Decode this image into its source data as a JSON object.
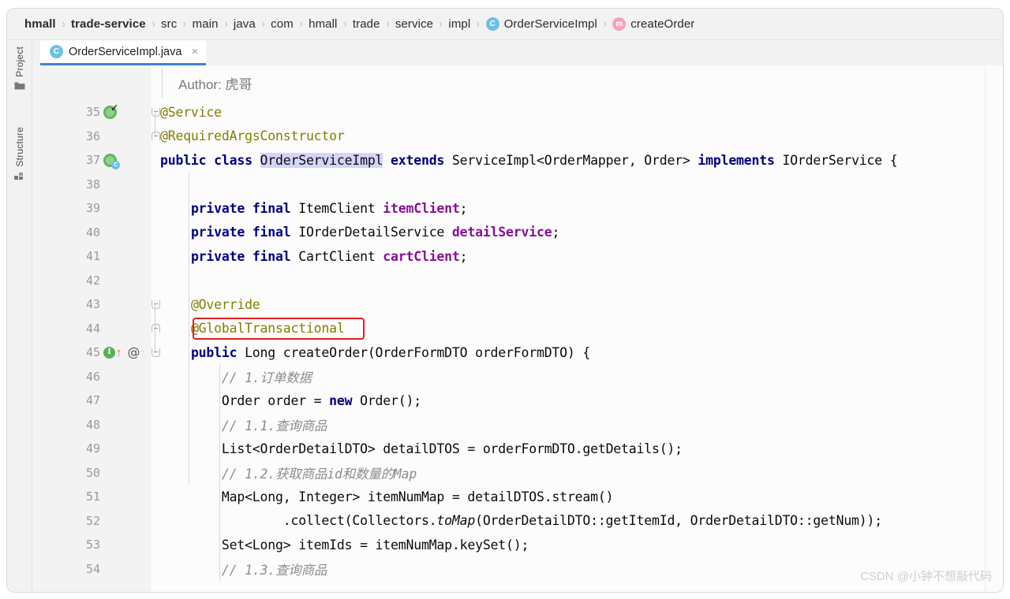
{
  "breadcrumb": {
    "separator": "›",
    "items": [
      {
        "label": "hmall",
        "bold": true,
        "icon": ""
      },
      {
        "label": "trade-service",
        "bold": true,
        "icon": ""
      },
      {
        "label": "src",
        "bold": false,
        "icon": ""
      },
      {
        "label": "main",
        "bold": false,
        "icon": ""
      },
      {
        "label": "java",
        "bold": false,
        "icon": ""
      },
      {
        "label": "com",
        "bold": false,
        "icon": ""
      },
      {
        "label": "hmall",
        "bold": false,
        "icon": ""
      },
      {
        "label": "trade",
        "bold": false,
        "icon": ""
      },
      {
        "label": "service",
        "bold": false,
        "icon": ""
      },
      {
        "label": "impl",
        "bold": false,
        "icon": ""
      },
      {
        "label": "OrderServiceImpl",
        "bold": false,
        "icon": "class-icon",
        "icon_char": "C"
      },
      {
        "label": "createOrder",
        "bold": false,
        "icon": "method-icon",
        "icon_char": "m"
      }
    ]
  },
  "tool_strip": {
    "project_label": "Project",
    "project_icon": "folder-icon",
    "structure_label": "Structure",
    "structure_icon": "blocks-icon"
  },
  "tab": {
    "icon_char": "C",
    "title": "OrderServiceImpl.java",
    "close_char": "×"
  },
  "editor": {
    "doc_comment": "Author: 虎哥",
    "lines": [
      {
        "no": "35",
        "gutter": "spring-bean-check",
        "fold": "down",
        "indent": 0,
        "tokens": [
          {
            "t": "@Service",
            "c": "ann"
          }
        ]
      },
      {
        "no": "36",
        "gutter": "",
        "fold": "up",
        "indent": 0,
        "tokens": [
          {
            "t": "@RequiredArgsConstructor",
            "c": "ann"
          }
        ]
      },
      {
        "no": "37",
        "gutter": "spring-bean-class",
        "fold": "",
        "indent": 0,
        "tokens": [
          {
            "t": "public",
            "c": "kw"
          },
          {
            "t": " ",
            "c": ""
          },
          {
            "t": "class",
            "c": "kw"
          },
          {
            "t": " ",
            "c": ""
          },
          {
            "t": "OrderServiceImpl",
            "c": "hl-sel"
          },
          {
            "t": " ",
            "c": ""
          },
          {
            "t": "extends",
            "c": "kw"
          },
          {
            "t": " ServiceImpl<OrderMapper, Order> ",
            "c": ""
          },
          {
            "t": "implements",
            "c": "kw"
          },
          {
            "t": " IOrderService {",
            "c": ""
          }
        ]
      },
      {
        "no": "38",
        "gutter": "",
        "fold": "",
        "indent": 0,
        "tokens": []
      },
      {
        "no": "39",
        "gutter": "",
        "fold": "",
        "indent": 1,
        "tokens": [
          {
            "t": "    ",
            "c": ""
          },
          {
            "t": "private",
            "c": "kw"
          },
          {
            "t": " ",
            "c": ""
          },
          {
            "t": "final",
            "c": "kw"
          },
          {
            "t": " ItemClient ",
            "c": ""
          },
          {
            "t": "itemClient",
            "c": "field"
          },
          {
            "t": ";",
            "c": ""
          }
        ]
      },
      {
        "no": "40",
        "gutter": "",
        "fold": "",
        "indent": 1,
        "tokens": [
          {
            "t": "    ",
            "c": ""
          },
          {
            "t": "private",
            "c": "kw"
          },
          {
            "t": " ",
            "c": ""
          },
          {
            "t": "final",
            "c": "kw"
          },
          {
            "t": " IOrderDetailService ",
            "c": ""
          },
          {
            "t": "detailService",
            "c": "field"
          },
          {
            "t": ";",
            "c": ""
          }
        ]
      },
      {
        "no": "41",
        "gutter": "",
        "fold": "",
        "indent": 1,
        "tokens": [
          {
            "t": "    ",
            "c": ""
          },
          {
            "t": "private",
            "c": "kw"
          },
          {
            "t": " ",
            "c": ""
          },
          {
            "t": "final",
            "c": "kw"
          },
          {
            "t": " CartClient ",
            "c": ""
          },
          {
            "t": "cartClient",
            "c": "field"
          },
          {
            "t": ";",
            "c": ""
          }
        ]
      },
      {
        "no": "42",
        "gutter": "",
        "fold": "",
        "indent": 1,
        "tokens": []
      },
      {
        "no": "43",
        "gutter": "",
        "fold": "down",
        "indent": 1,
        "tokens": [
          {
            "t": "    ",
            "c": ""
          },
          {
            "t": "@Override",
            "c": "ann"
          }
        ]
      },
      {
        "no": "44",
        "gutter": "",
        "fold": "up",
        "indent": 1,
        "tokens": [
          {
            "t": "    ",
            "c": ""
          },
          {
            "t": "@GlobalTransactional",
            "c": "ann"
          }
        ]
      },
      {
        "no": "45",
        "gutter": "implements-method",
        "fold": "down",
        "indent": 1,
        "tokens": [
          {
            "t": "    ",
            "c": ""
          },
          {
            "t": "public",
            "c": "kw"
          },
          {
            "t": " Long createOrder(OrderFormDTO orderFormDTO) {",
            "c": ""
          }
        ]
      },
      {
        "no": "46",
        "gutter": "",
        "fold": "",
        "indent": 2,
        "tokens": [
          {
            "t": "        ",
            "c": ""
          },
          {
            "t": "// 1.订单数据",
            "c": "cmt"
          }
        ]
      },
      {
        "no": "47",
        "gutter": "",
        "fold": "",
        "indent": 2,
        "tokens": [
          {
            "t": "        Order order = ",
            "c": ""
          },
          {
            "t": "new",
            "c": "kw"
          },
          {
            "t": " Order();",
            "c": ""
          }
        ]
      },
      {
        "no": "48",
        "gutter": "",
        "fold": "",
        "indent": 2,
        "tokens": [
          {
            "t": "        ",
            "c": ""
          },
          {
            "t": "// 1.1.查询商品",
            "c": "cmt"
          }
        ]
      },
      {
        "no": "49",
        "gutter": "",
        "fold": "",
        "indent": 2,
        "tokens": [
          {
            "t": "        List<OrderDetailDTO> detailDTOS = orderFormDTO.getDetails();",
            "c": ""
          }
        ]
      },
      {
        "no": "50",
        "gutter": "",
        "fold": "",
        "indent": 2,
        "tokens": [
          {
            "t": "        ",
            "c": ""
          },
          {
            "t": "// 1.2.获取商品id和数量的Map",
            "c": "cmt"
          }
        ]
      },
      {
        "no": "51",
        "gutter": "",
        "fold": "",
        "indent": 2,
        "tokens": [
          {
            "t": "        Map<Long, Integer> itemNumMap = detailDTOS.stream()",
            "c": ""
          }
        ]
      },
      {
        "no": "52",
        "gutter": "",
        "fold": "",
        "indent": 2,
        "tokens": [
          {
            "t": "                .collect(Collectors.",
            "c": ""
          },
          {
            "t": "toMap",
            "c": "stat"
          },
          {
            "t": "(OrderDetailDTO::getItemId, OrderDetailDTO::getNum));",
            "c": ""
          }
        ]
      },
      {
        "no": "53",
        "gutter": "",
        "fold": "",
        "indent": 2,
        "tokens": [
          {
            "t": "        Set<Long> itemIds = itemNumMap.keySet();",
            "c": ""
          }
        ]
      },
      {
        "no": "54",
        "gutter": "",
        "fold": "",
        "indent": 2,
        "tokens": [
          {
            "t": "        ",
            "c": ""
          },
          {
            "t": "// 1.3.查询商品",
            "c": "cmt"
          }
        ]
      }
    ]
  },
  "annotation": {
    "highlight_target": "@GlobalTransactional",
    "color": "#e02020"
  },
  "watermark": "CSDN @小钟不想敲代码",
  "colors": {
    "keyword": "#000080",
    "annotation_token": "#808000",
    "comment": "#8c8c8c",
    "field": "#871094",
    "tab_underline": "#3e82d6",
    "class_icon": "#6cc0e5",
    "method_icon": "#f2a2bd",
    "red_box": "#e02020"
  }
}
